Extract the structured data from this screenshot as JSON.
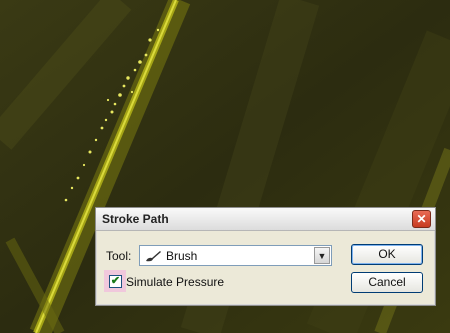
{
  "dialog": {
    "title": "Stroke Path",
    "tool_label": "Tool:",
    "tool_value": "Brush",
    "tool_icon": "brush-icon",
    "simulate_pressure_label": "Simulate Pressure",
    "simulate_pressure_checked": true,
    "ok_label": "OK",
    "cancel_label": "Cancel",
    "close_glyph": "✕"
  }
}
